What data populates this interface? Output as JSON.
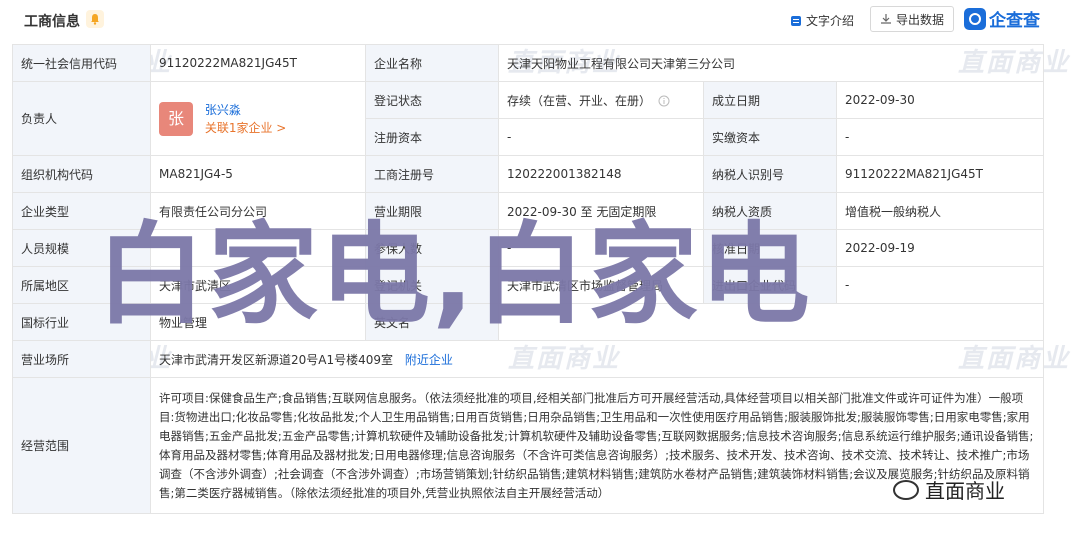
{
  "header": {
    "title": "工商信息",
    "intro_label": "文字介绍",
    "export_label": "导出数据",
    "brand": "企查查"
  },
  "watermark": "直面商业",
  "overlay_text": "白家电,白家电",
  "rows": {
    "credit_code": {
      "label": "统一社会信用代码",
      "value": "91120222MA821JG45T"
    },
    "company_name": {
      "label": "企业名称",
      "value": "天津天阳物业工程有限公司天津第三分公司"
    },
    "legal_person": {
      "label": "负责人",
      "avatar": "张",
      "name": "张兴淼",
      "relate": "关联1家企业 >"
    },
    "reg_status": {
      "label": "登记状态",
      "value": "存续（在营、开业、在册）"
    },
    "found_date": {
      "label": "成立日期",
      "value": "2022-09-30"
    },
    "reg_capital": {
      "label": "注册资本",
      "value": "-"
    },
    "paid_capital": {
      "label": "实缴资本",
      "value": "-"
    },
    "org_code": {
      "label": "组织机构代码",
      "value": "MA821JG4-5"
    },
    "reg_no": {
      "label": "工商注册号",
      "value": "120222001382148"
    },
    "tax_id": {
      "label": "纳税人识别号",
      "value": "91120222MA821JG45T"
    },
    "company_type": {
      "label": "企业类型",
      "value": "有限责任公司分公司"
    },
    "biz_term": {
      "label": "营业期限",
      "value": "2022-09-30 至 无固定期限"
    },
    "taxpayer_qual": {
      "label": "纳税人资质",
      "value": "增值税一般纳税人"
    },
    "staff_size": {
      "label": "人员规模",
      "value": ""
    },
    "insured": {
      "label": "参保人数",
      "value": "-"
    },
    "approve_date": {
      "label": "核准日期",
      "value": "2022-09-19"
    },
    "region": {
      "label": "所属地区",
      "value": "天津市武清区"
    },
    "reg_authority": {
      "label": "登记机关",
      "value": "天津市武清区市场监督管理局"
    },
    "import_export": {
      "label": "进出口企业代码",
      "value": "-"
    },
    "industry": {
      "label": "国标行业",
      "value": "物业管理"
    },
    "english_name": {
      "label": "英文名",
      "value": ""
    },
    "address": {
      "label": "营业场所",
      "value": "天津市武清开发区新源道20号A1号楼409室",
      "nearby": "附近企业"
    },
    "scope": {
      "label": "经营范围",
      "value": "许可项目:保健食品生产;食品销售;互联网信息服务。（依法须经批准的项目,经相关部门批准后方可开展经营活动,具体经营项目以相关部门批准文件或许可证件为准）一般项目:货物进出口;化妆品零售;化妆品批发;个人卫生用品销售;日用百货销售;日用杂品销售;卫生用品和一次性使用医疗用品销售;服装服饰批发;服装服饰零售;日用家电零售;家用电器销售;五金产品批发;五金产品零售;计算机软硬件及辅助设备批发;计算机软硬件及辅助设备零售;互联网数据服务;信息技术咨询服务;信息系统运行维护服务;通讯设备销售;体育用品及器材零售;体育用品及器材批发;日用电器修理;信息咨询服务（不含许可类信息咨询服务）;技术服务、技术开发、技术咨询、技术交流、技术转让、技术推广;市场调查（不含涉外调查）;社会调查（不含涉外调查）;市场营销策划;针纺织品销售;建筑材料销售;建筑防水卷材产品销售;建筑装饰材料销售;会议及展览服务;针纺织品及原料销售;第二类医疗器械销售。（除依法须经批准的项目外,凭营业执照依法自主开展经营活动）"
    }
  },
  "wechat_label": "直面商业"
}
